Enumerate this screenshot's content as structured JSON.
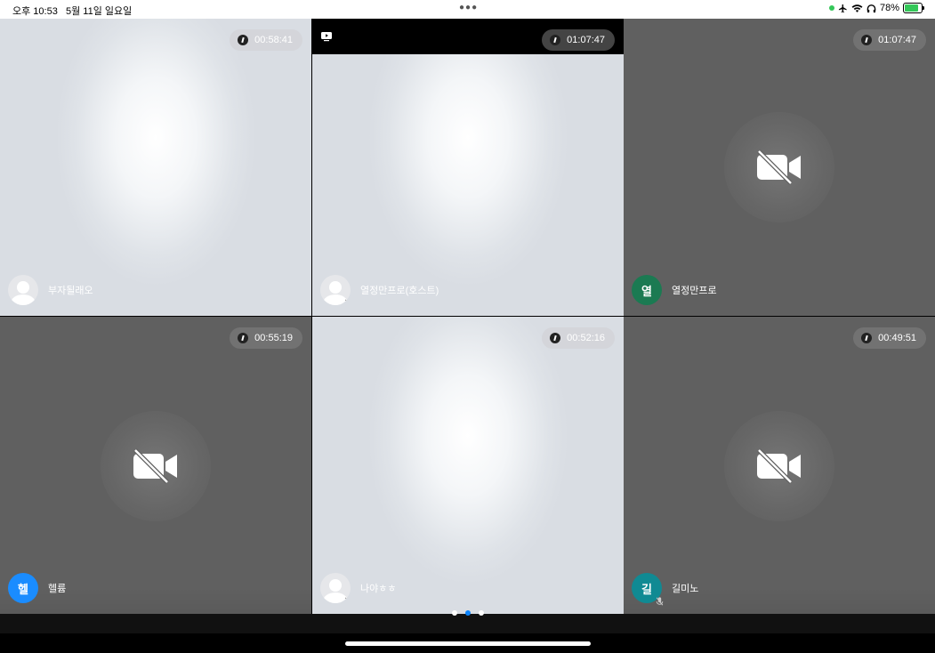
{
  "status_bar": {
    "time": "오후 10:53",
    "date": "5월 11일 일요일",
    "battery": "78%",
    "battery_level": 0.78
  },
  "tiles": [
    {
      "name": "부자될래오",
      "timer": "00:58:41",
      "video": "on",
      "avatar": "default"
    },
    {
      "name": "열정만프로(호스트)",
      "timer": "01:07:47",
      "video": "on",
      "avatar": "default",
      "muted": true,
      "host_bar": true
    },
    {
      "name": "열정만프로",
      "timer": "01:07:47",
      "video": "off",
      "avatar": "initial",
      "initial": "열",
      "avatar_color": "#1b7a52"
    },
    {
      "name": "헬륨",
      "timer": "00:55:19",
      "video": "off",
      "avatar": "initial",
      "initial": "헬",
      "avatar_color": "#1a8cff"
    },
    {
      "name": "나야ㅎㅎ",
      "timer": "00:52:16",
      "video": "on",
      "avatar": "default",
      "muted": true
    },
    {
      "name": "길미노",
      "timer": "00:49:51",
      "video": "off",
      "avatar": "initial",
      "initial": "길",
      "avatar_color": "#108a93",
      "muted": true
    }
  ],
  "pager": {
    "pages": 3,
    "active": 1
  },
  "icons": {
    "timer": "stopwatch-icon",
    "camera_off": "video-off-icon",
    "mute": "mic-off-icon",
    "screen_share": "screen-share-icon"
  }
}
